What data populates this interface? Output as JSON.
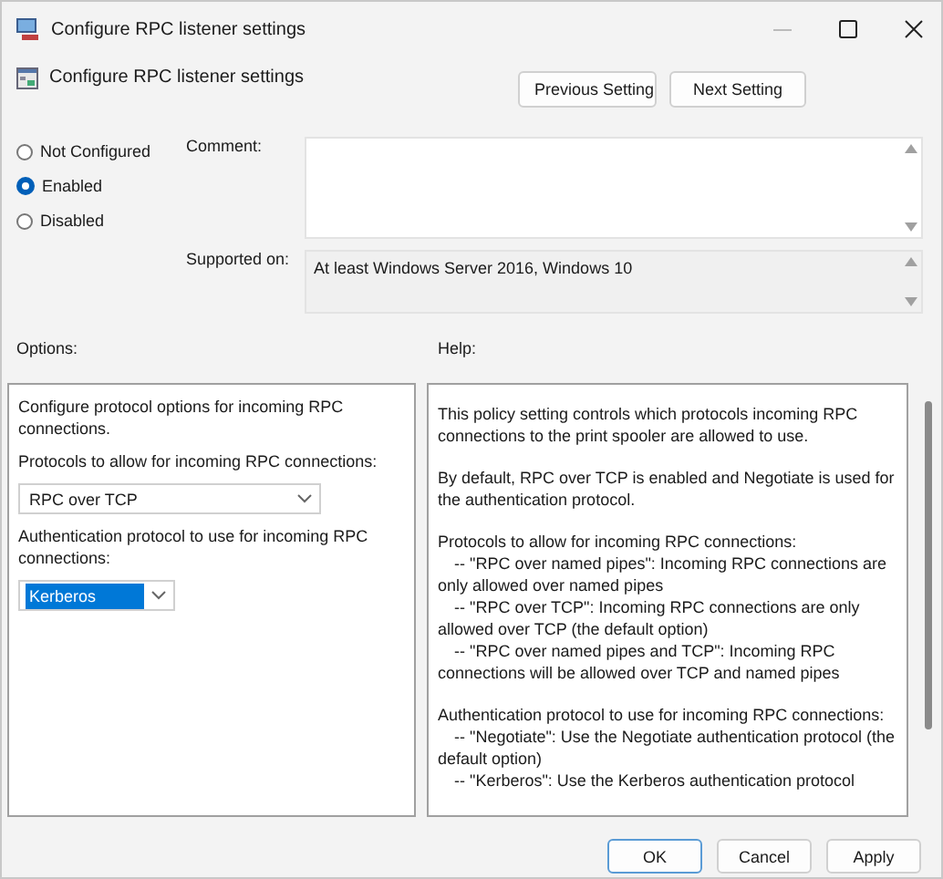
{
  "window": {
    "title": "Configure RPC listener settings"
  },
  "header": {
    "title": "Configure RPC listener settings",
    "buttons": [
      "Previous Setting",
      "Next Setting"
    ]
  },
  "states": [
    {
      "label": "Not Configured",
      "selected": false
    },
    {
      "label": "Enabled",
      "selected": true
    },
    {
      "label": "Disabled",
      "selected": false
    }
  ],
  "comment": {
    "label": "Comment:"
  },
  "supported_on": {
    "label": "Supported on:",
    "value": "At least Windows Server 2016, Windows 10"
  },
  "options": {
    "label": "Options:",
    "items": [
      {
        "kind": "text",
        "text": "Configure protocol options for incoming RPC connections."
      },
      {
        "kind": "text",
        "text": "Protocols to allow for incoming RPC connections:"
      },
      {
        "kind": "dropdown",
        "value": "RPC over TCP",
        "selected": false
      },
      {
        "kind": "text",
        "text": "Authentication protocol to use for incoming RPC connections:"
      },
      {
        "kind": "dropdown",
        "value": "Kerberos",
        "selected": true
      }
    ]
  },
  "help": {
    "label": "Help:",
    "paragraphs": [
      [
        {
          "text": "This policy setting controls which protocols incoming RPC connections to the print spooler are allowed to use.",
          "indent": false
        }
      ],
      [
        {
          "text": "By default, RPC over TCP is enabled and Negotiate is used for the authentication protocol.",
          "indent": false
        }
      ],
      [
        {
          "text": "Protocols to allow for incoming RPC connections:",
          "indent": false
        },
        {
          "text": "-- \"RPC over named pipes\": Incoming RPC connections are only allowed over named pipes",
          "indent": true
        },
        {
          "text": "-- \"RPC over TCP\": Incoming RPC connections are only allowed over TCP (the default option)",
          "indent": true
        },
        {
          "text": "-- \"RPC over named pipes and TCP\": Incoming RPC connections will be allowed over TCP and named pipes",
          "indent": true
        }
      ],
      [
        {
          "text": "Authentication protocol to use for incoming RPC connections:",
          "indent": false
        },
        {
          "text": "-- \"Negotiate\": Use the Negotiate authentication protocol (the default option)",
          "indent": true
        },
        {
          "text": "-- \"Kerberos\": Use the Kerberos authentication protocol",
          "indent": true
        }
      ]
    ]
  },
  "footer": {
    "buttons": [
      {
        "label": "OK",
        "selected": true
      },
      {
        "label": "Cancel",
        "selected": false
      },
      {
        "label": "Apply",
        "selected": false
      }
    ]
  }
}
